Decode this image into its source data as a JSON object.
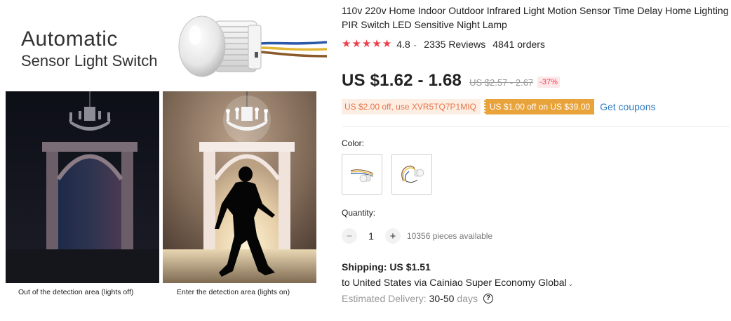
{
  "image": {
    "headline_line1": "Automatic",
    "headline_line2": "Sensor Light Switch",
    "caption_left": "Out of the detection area (lights off)",
    "caption_right": "Enter the detection area (lights on)"
  },
  "product": {
    "title": "110v 220v Home Indoor Outdoor Infrared Light Motion Sensor Time Delay Home Lighting PIR Switch LED Sensitive Night Lamp",
    "rating": "4.8",
    "stars": 5,
    "reviews": "2335 Reviews",
    "orders": "4841 orders",
    "price": "US $1.62 - 1.68",
    "old_price": "US $2.57 - 2.67",
    "discount": "-37%"
  },
  "coupons": {
    "store_coupon": "US $2.00 off, use XVR5TQ7P1MIQ",
    "promo_coupon": "US $1.00 off on US $39.00",
    "get_coupons_link": "Get coupons"
  },
  "color": {
    "label": "Color:",
    "options": [
      "sensor-with-short-leads",
      "sensor-with-coiled-leads"
    ]
  },
  "quantity": {
    "label": "Quantity:",
    "minus": "−",
    "value": "1",
    "plus": "+",
    "available": "10356 pieces available"
  },
  "shipping": {
    "title": "Shipping: US $1.51",
    "route": "to United States via Cainiao Super Economy Global",
    "delivery_label": "Estimated Delivery:",
    "delivery_value": "30-50",
    "delivery_unit": "days",
    "help_symbol": "?"
  },
  "colors": {
    "star": "#ef3e4a",
    "link": "#2f7bc0",
    "coupon_orange": "#e9a33b",
    "discount_red": "#ef3e4a"
  }
}
